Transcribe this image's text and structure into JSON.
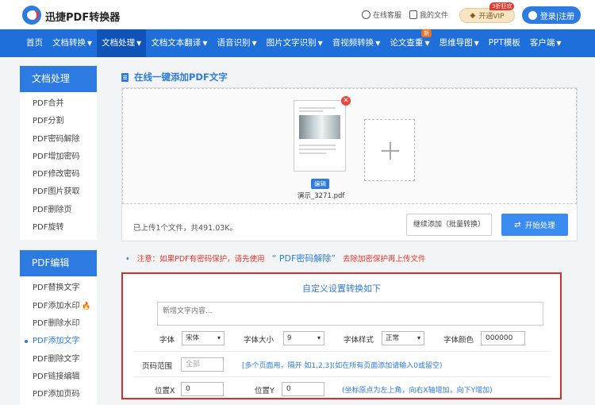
{
  "header": {
    "brand": "迅捷PDF转换器",
    "service": "在线客服",
    "my_files": "我的文件",
    "vip_label": "开通VIP",
    "vip_badge": "3折狂欢",
    "login": "登录|注册"
  },
  "nav": {
    "items": [
      {
        "label": "首页",
        "caret": false
      },
      {
        "label": "文档转换",
        "caret": true
      },
      {
        "label": "文档处理",
        "caret": true,
        "active": true
      },
      {
        "label": "文档文本翻译",
        "caret": true
      },
      {
        "label": "语音识别",
        "caret": true
      },
      {
        "label": "图片文字识别",
        "caret": true
      },
      {
        "label": "音视频转换",
        "caret": true
      },
      {
        "label": "论文查重",
        "caret": true
      },
      {
        "label": "思维导图",
        "caret": true
      },
      {
        "label": "PPT模板",
        "caret": false
      },
      {
        "label": "客户端",
        "caret": true
      }
    ],
    "new_badge": "新"
  },
  "sidebar": {
    "section1_title": "文档处理",
    "section1_items": [
      "PDF合并",
      "PDF分割",
      "PDF密码解除",
      "PDF增加密码",
      "PDF修改密码",
      "PDF图片获取",
      "PDF删除页",
      "PDF旋转"
    ],
    "section2_title": "PDF编辑",
    "section2_items": [
      "PDF替换文字",
      "PDF添加水印",
      "PDF删除水印",
      "PDF添加文字",
      "PDF删除文字",
      "PDF链接编辑",
      "PDF添加页码",
      "PDF删除图片"
    ],
    "active_item": "PDF添加文字"
  },
  "main": {
    "title": "在线一键添加PDF文字",
    "file_edit_tag": "编辑",
    "file_name": "演示_3271.pdf",
    "upload_info": "已上传1个文件，共491.03K。",
    "continue_btn": "继续添加（批量转换）",
    "start_btn": "开始处理",
    "note_prefix": "注意：如果PDF有密码保护，请先使用",
    "note_link": "“ PDF密码解除”",
    "note_suffix": "去除加密保护再上传文件"
  },
  "settings": {
    "title": "自定义设置转换如下",
    "textarea_placeholder": "新增文字内容...",
    "font_label": "字体",
    "font_value": "宋体",
    "size_label": "字体大小",
    "size_value": "9",
    "style_label": "字体样式",
    "style_value": "正常",
    "color_label": "字体颜色",
    "color_value": "000000",
    "page_range_label": "页码范围",
    "page_range_placeholder": "全部",
    "page_range_hint": "[多个页面用，隔开 如1,2,3](如在所有页面添加请输入0或留空)",
    "pos_x_label": "位置X",
    "pos_x_value": "0",
    "pos_y_label": "位置Y",
    "pos_y_value": "0",
    "pos_hint": "(坐标原点为左上角，向右X轴增加，向下Y增加)"
  },
  "colors": {
    "primary": "#2d7be0",
    "nav_bg": "#1e6fd9",
    "highlight_border": "#d0312d",
    "note_red": "#e8372c"
  }
}
